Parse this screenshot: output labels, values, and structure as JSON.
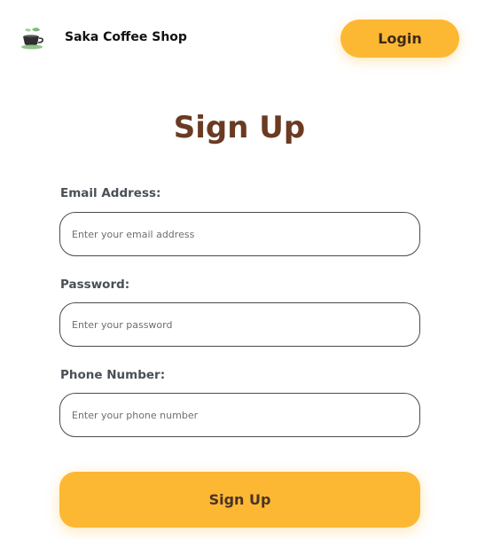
{
  "header": {
    "brand_name": "Saka Coffee Shop",
    "logo_icon": "coffee-cup-icon",
    "login_label": "Login"
  },
  "main": {
    "title": "Sign Up",
    "fields": [
      {
        "label": "Email Address:",
        "placeholder": "Enter your email address",
        "value": ""
      },
      {
        "label": "Password:",
        "placeholder": "Enter your password",
        "value": ""
      },
      {
        "label": "Phone Number:",
        "placeholder": "Enter your phone number",
        "value": ""
      }
    ],
    "submit_label": "Sign Up"
  },
  "colors": {
    "accent": "#FDB833",
    "title": "#6B3A22",
    "label": "#4a4f57",
    "logo_green": "#7fb87a"
  }
}
